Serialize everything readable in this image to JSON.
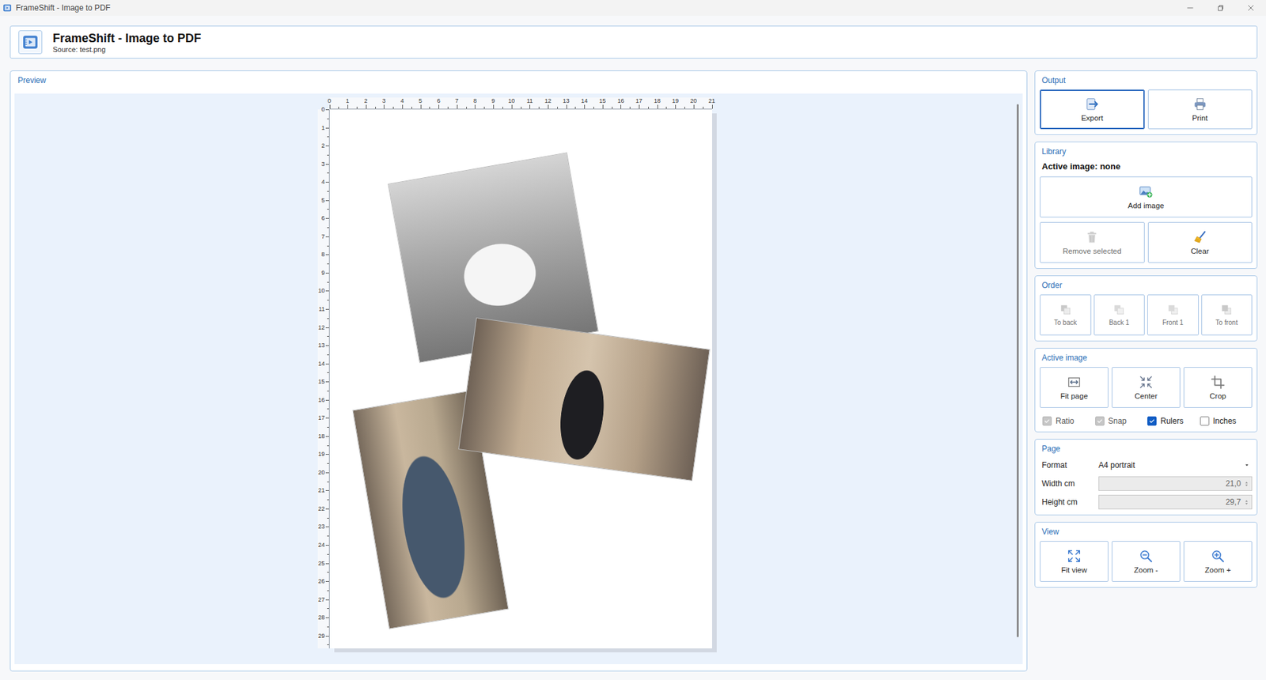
{
  "window": {
    "title": "FrameShift - Image to PDF"
  },
  "header": {
    "title": "FrameShift - Image to PDF",
    "subtitle": "Source: test.png"
  },
  "preview": {
    "label": "Preview",
    "ruler_top": [
      "0",
      "1",
      "2",
      "3",
      "4",
      "5",
      "6",
      "7",
      "8",
      "9",
      "10",
      "11",
      "12",
      "13",
      "14",
      "15",
      "16",
      "17",
      "18",
      "19",
      "20",
      "21"
    ],
    "ruler_left": [
      "0",
      "1",
      "2",
      "3",
      "4",
      "5",
      "6",
      "7",
      "8",
      "9",
      "10",
      "11",
      "12",
      "13",
      "14",
      "15",
      "16",
      "17",
      "18",
      "19",
      "20",
      "21",
      "22",
      "23",
      "24",
      "25",
      "26",
      "27",
      "28",
      "29"
    ],
    "scroll_level": 0.97
  },
  "output": {
    "label": "Output",
    "buttons": [
      {
        "label": "Export",
        "selected": true,
        "disabled": false
      },
      {
        "label": "Print",
        "selected": false,
        "disabled": false
      }
    ]
  },
  "library": {
    "label": "Library",
    "status": "Active image: none",
    "add_button": {
      "label": "Add image",
      "disabled": false
    },
    "buttons": [
      {
        "label": "Remove selected",
        "disabled": true
      },
      {
        "label": "Clear",
        "disabled": false
      }
    ]
  },
  "order": {
    "label": "Order",
    "buttons": [
      {
        "label": "To back",
        "disabled": true
      },
      {
        "label": "Back 1",
        "disabled": true
      },
      {
        "label": "Front 1",
        "disabled": true
      },
      {
        "label": "To front",
        "disabled": true
      }
    ]
  },
  "active_image": {
    "label": "Active image",
    "buttons": [
      {
        "label": "Fit page",
        "disabled": false
      },
      {
        "label": "Center",
        "disabled": false
      },
      {
        "label": "Crop",
        "disabled": false
      }
    ],
    "options": [
      {
        "label": "Ratio",
        "checked": true,
        "disabled": true
      },
      {
        "label": "Snap",
        "checked": true,
        "disabled": true
      },
      {
        "label": "Rulers",
        "checked": true,
        "disabled": false
      },
      {
        "label": "Inches",
        "checked": false,
        "disabled": false
      }
    ]
  },
  "page": {
    "label": "Page",
    "fields": [
      {
        "label": "Format",
        "value": "A4 portrait",
        "kind": "select",
        "disabled": false
      },
      {
        "label": "Width cm",
        "value": "21,0",
        "kind": "spin",
        "disabled": true
      },
      {
        "label": "Height cm",
        "value": "29,7",
        "kind": "spin",
        "disabled": true
      }
    ]
  },
  "view": {
    "label": "View",
    "buttons": [
      {
        "label": "Fit view",
        "disabled": false
      },
      {
        "label": "Zoom -",
        "disabled": false
      },
      {
        "label": "Zoom +",
        "disabled": false
      }
    ]
  }
}
